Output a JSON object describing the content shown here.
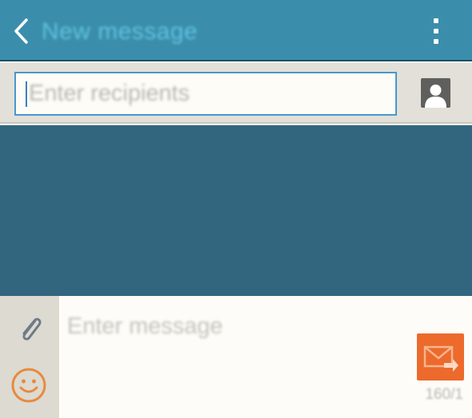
{
  "appbar": {
    "title": "New message",
    "back_icon": "chevron-left-icon",
    "menu_icon": "more-vertical-icon"
  },
  "recipients": {
    "placeholder": "Enter recipients",
    "contact_icon": "contact-person-icon"
  },
  "composer": {
    "placeholder": "Enter message",
    "attach_icon": "paperclip-icon",
    "emoji_icon": "smiley-icon",
    "send_icon": "send-mail-icon",
    "counter": "160/1"
  },
  "colors": {
    "appbar": "#3b8eab",
    "title_text": "#5ec1e0",
    "conversation_bg": "#32667e",
    "input_border": "#4a97cc",
    "send_button": "#ec6a2c",
    "emoji": "#e8893f"
  }
}
